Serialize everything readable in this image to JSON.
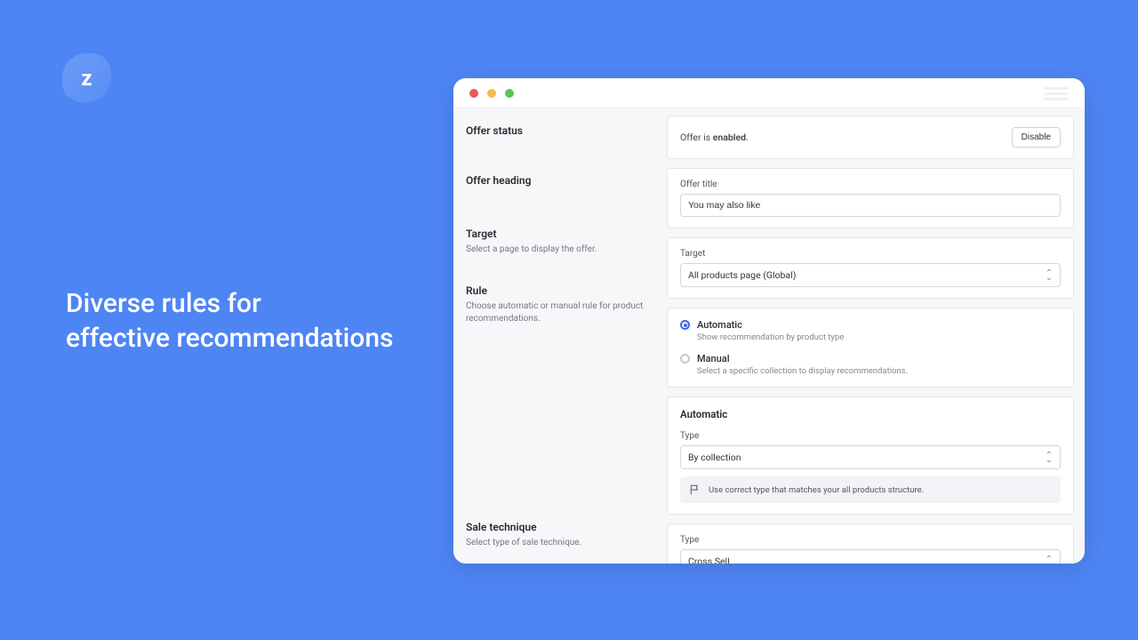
{
  "hero": {
    "line1": "Diverse rules for",
    "line2": "effective recommendations"
  },
  "logo": {
    "letter": "z"
  },
  "sections": {
    "status": {
      "title": "Offer status"
    },
    "heading": {
      "title": "Offer heading"
    },
    "target": {
      "title": "Target",
      "desc": "Select a page to display the offer."
    },
    "rule": {
      "title": "Rule",
      "desc": "Choose automatic or manual rule for product recommendations."
    },
    "technique": {
      "title": "Sale technique",
      "desc": "Select type of sale technique."
    }
  },
  "panels": {
    "status": {
      "text_prefix": "Offer is ",
      "text_state": "enabled",
      "text_suffix": ".",
      "button": "Disable"
    },
    "title": {
      "label": "Offer title",
      "value": "You may also like"
    },
    "target": {
      "label": "Target",
      "value": "All products page (Global)"
    },
    "rule": {
      "automatic": {
        "title": "Automatic",
        "desc": "Show recommendation by product type"
      },
      "manual": {
        "title": "Manual",
        "desc": "Select a specific collection to display recommendations."
      }
    },
    "auto": {
      "title": "Automatic",
      "type_label": "Type",
      "type_value": "By collection",
      "hint": "Use correct type that matches your all products structure."
    },
    "technique": {
      "label": "Type",
      "value": "Cross Sell"
    }
  }
}
